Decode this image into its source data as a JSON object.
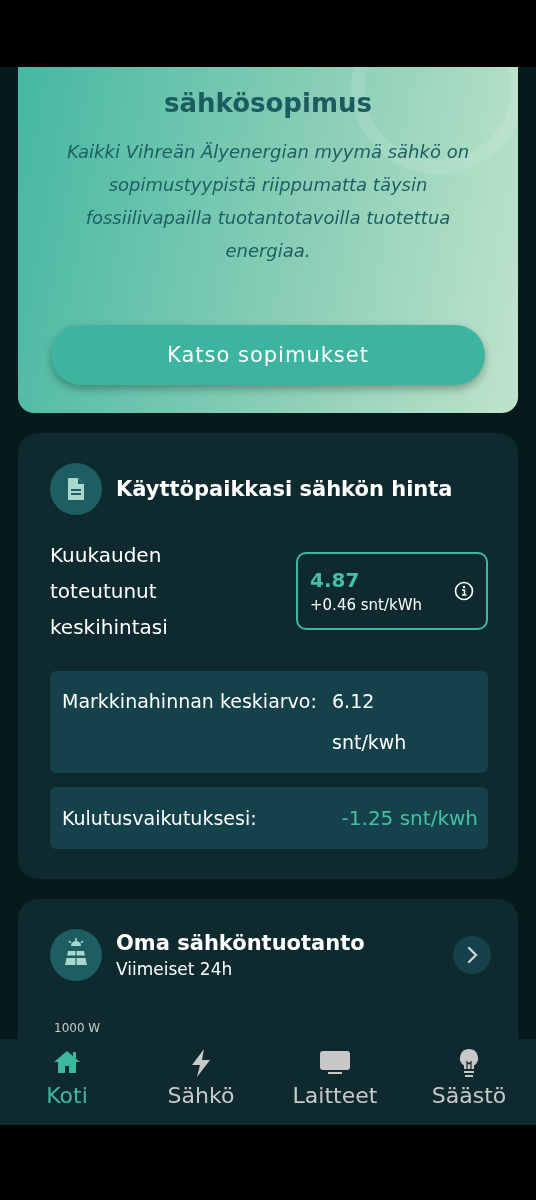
{
  "hero": {
    "title": "sähkösopimus",
    "description": "Kaikki Vihreän Älyenergian myymä sähkö on sopimustyypistä riippumatta täysin fossiilivapailla tuotantotavoilla tuotettua energiaa.",
    "button": "Katso sopimukset"
  },
  "price_card": {
    "title": "Käyttöpaikkasi sähkön hinta",
    "monthly_label": "Kuukauden toteutunut keskihintasi",
    "monthly_value": "4.87",
    "monthly_delta": "+0.46 snt/kWh",
    "market_label": "Markkinahinnan keskiarvo:",
    "market_value": "6.12 snt/kwh",
    "consumption_label": "Kulutusvaikutuksesi:",
    "consumption_value": "-1.25 snt/kwh"
  },
  "production_card": {
    "title": "Oma sähköntuotanto",
    "subtitle": "Viimeiset 24h",
    "axis_label": "1000 W"
  },
  "nav": [
    {
      "kind": "home",
      "label": "Koti",
      "selected": true
    },
    {
      "kind": "bolt",
      "label": "Sähkö",
      "selected": false
    },
    {
      "kind": "devices",
      "label": "Laitteet",
      "selected": false
    },
    {
      "kind": "bulb",
      "label": "Säästö",
      "selected": false
    }
  ]
}
